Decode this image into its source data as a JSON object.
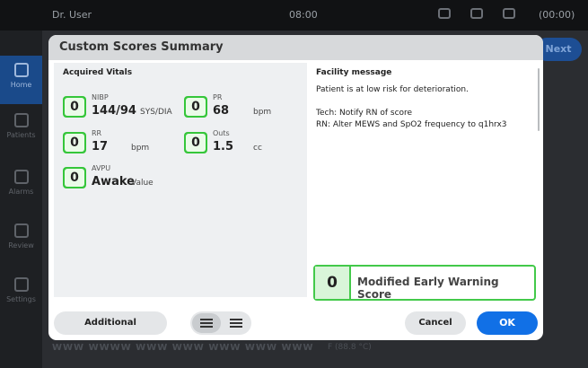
{
  "topbar": {
    "user": "Dr. User",
    "time": "08:00",
    "clock": "(00:00)"
  },
  "sidebar": {
    "items": [
      {
        "label": "Home",
        "active": true
      },
      {
        "label": "Patients",
        "active": false
      },
      {
        "label": "Alarms",
        "active": false
      },
      {
        "label": "Review",
        "active": false
      },
      {
        "label": "Settings",
        "active": false
      }
    ]
  },
  "background": {
    "next_label": "Next",
    "bottom_text": "WWW WWWW WWW WWW WWW WWW WWW",
    "bottom_value": "F (88.8 °C)"
  },
  "modal": {
    "title": "Custom Scores Summary",
    "acquired_title": "Acquired Vitals",
    "vitals": {
      "nibp": {
        "label": "NIBP",
        "score": "0",
        "value": "144/94",
        "unit": "SYS/DIA"
      },
      "pr": {
        "label": "PR",
        "score": "0",
        "value": "68",
        "unit": "bpm"
      },
      "rr": {
        "label": "RR",
        "score": "0",
        "value": "17",
        "unit": "bpm"
      },
      "outs": {
        "label": "Outs",
        "score": "0",
        "value": "1.5",
        "unit": "cc"
      },
      "avpu": {
        "label": "AVPU",
        "score": "0",
        "value": "Awake",
        "unit": "Value"
      }
    },
    "facility": {
      "title": "Facility message",
      "line1": "Patient is at low risk for deterioration.",
      "line2": "Tech: Notify RN of score",
      "line3": "RN: Alter MEWS and SpO2 frequency to q1hrx3"
    },
    "mews": {
      "score": "0",
      "label": "Modified Early Warning Score"
    },
    "footer": {
      "additional_label": "Additional Parameters",
      "cancel_label": "Cancel",
      "ok_label": "OK"
    }
  }
}
